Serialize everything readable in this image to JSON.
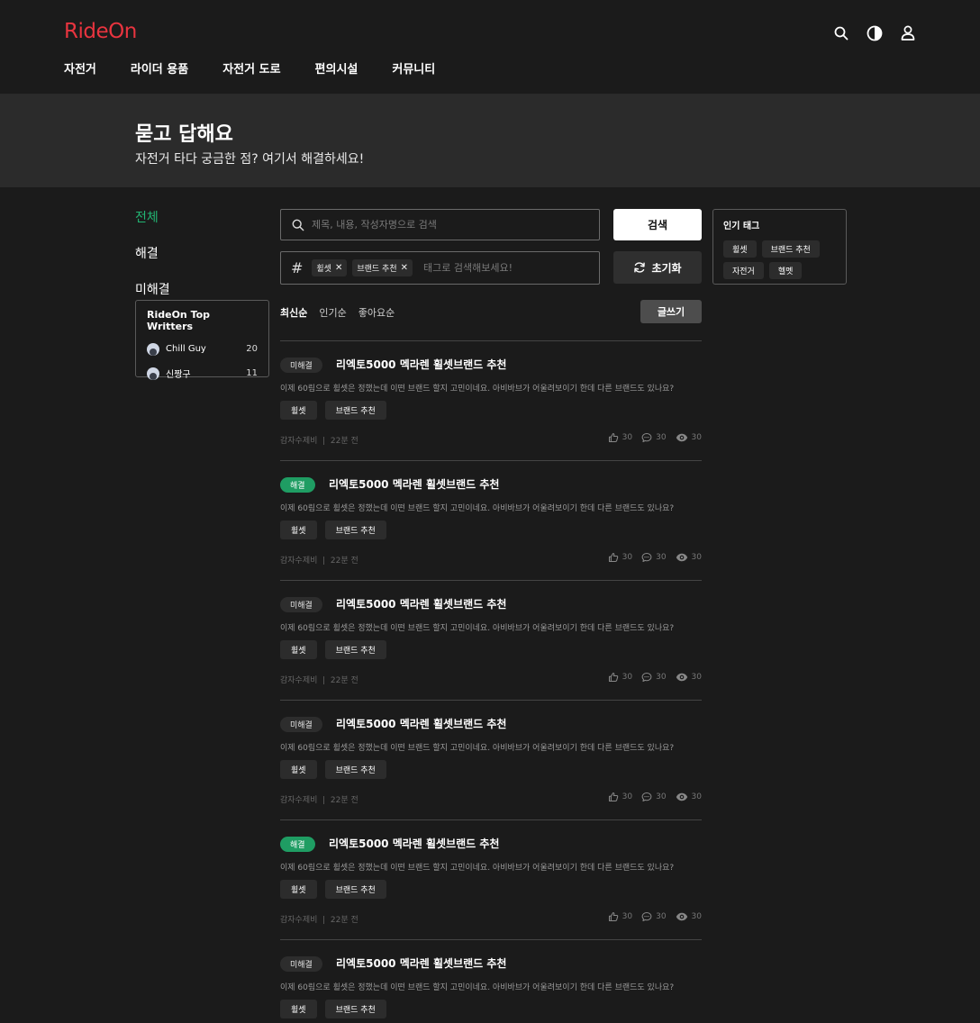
{
  "header": {
    "logo": "RideOn",
    "nav": [
      "자전거",
      "라이더 용품",
      "자전거 도로",
      "편의시설",
      "커뮤니티"
    ],
    "icons": [
      "search-icon",
      "theme-toggle-icon",
      "user-icon"
    ]
  },
  "banner": {
    "title": "묻고 답해요",
    "subtitle": "자전거 타다 궁금한 점? 여기서 해결하세요!"
  },
  "filters": [
    "전체",
    "해결",
    "미해결"
  ],
  "top_writers": {
    "title": "RideOn Top Writters",
    "writers": [
      {
        "name": "Chill Guy",
        "count": "20"
      },
      {
        "name": "신짱구",
        "count": "11"
      }
    ]
  },
  "search": {
    "placeholder": "제목, 내용, 작성자명으로 검색",
    "button": "검색"
  },
  "tag_search": {
    "chips": [
      "휠셋",
      "브랜드 추천"
    ],
    "placeholder": "태그로 검색해보세요!",
    "reset_button": "초기화"
  },
  "popular_tags": {
    "title": "인기 태그",
    "tags": [
      "휠셋",
      "브랜드 추천",
      "자전거",
      "헬멧"
    ]
  },
  "sort": [
    "최신순",
    "인기순",
    "좋아요순"
  ],
  "write_button": "글쓰기",
  "posts": [
    {
      "status": "미해결",
      "solved": false,
      "title": "리엑토5000 멕라렌 휠셋브랜드 추천",
      "desc": "이제 60림으로 휠셋은 정했는데 이떤 브랜드 할지 고민이네요. 아비바브가 어울려보이기 한데 다른 브랜드도 있나요?",
      "tags": [
        "휠셋",
        "브랜드 추천"
      ],
      "author": "감자수제비",
      "time": "22분 전",
      "likes": "30",
      "comments": "30",
      "views": "30"
    },
    {
      "status": "해결",
      "solved": true,
      "title": "리엑토5000 멕라렌 휠셋브랜드 추천",
      "desc": "이제 60림으로 휠셋은 정했는데 이떤 브랜드 할지 고민이네요. 아비바브가 어울려보이기 한데 다른 브랜드도 있나요?",
      "tags": [
        "휠셋",
        "브랜드 추천"
      ],
      "author": "감자수제비",
      "time": "22분 전",
      "likes": "30",
      "comments": "30",
      "views": "30"
    },
    {
      "status": "미해결",
      "solved": false,
      "title": "리엑토5000 멕라렌 휠셋브랜드 추천",
      "desc": "이제 60림으로 휠셋은 정했는데 이떤 브랜드 할지 고민이네요. 아비바브가 어울려보이기 한데 다른 브랜드도 있나요?",
      "tags": [
        "휠셋",
        "브랜드 추천"
      ],
      "author": "감자수제비",
      "time": "22분 전",
      "likes": "30",
      "comments": "30",
      "views": "30"
    },
    {
      "status": "미해결",
      "solved": false,
      "title": "리엑토5000 멕라렌 휠셋브랜드 추천",
      "desc": "이제 60림으로 휠셋은 정했는데 이떤 브랜드 할지 고민이네요. 아비바브가 어울려보이기 한데 다른 브랜드도 있나요?",
      "tags": [
        "휠셋",
        "브랜드 추천"
      ],
      "author": "감자수제비",
      "time": "22분 전",
      "likes": "30",
      "comments": "30",
      "views": "30"
    },
    {
      "status": "해결",
      "solved": true,
      "title": "리엑토5000 멕라렌 휠셋브랜드 추천",
      "desc": "이제 60림으로 휠셋은 정했는데 이떤 브랜드 할지 고민이네요. 아비바브가 어울려보이기 한데 다른 브랜드도 있나요?",
      "tags": [
        "휠셋",
        "브랜드 추천"
      ],
      "author": "감자수제비",
      "time": "22분 전",
      "likes": "30",
      "comments": "30",
      "views": "30"
    },
    {
      "status": "미해결",
      "solved": false,
      "title": "리엑토5000 멕라렌 휠셋브랜드 추천",
      "desc": "이제 60림으로 휠셋은 정했는데 이떤 브랜드 할지 고민이네요. 아비바브가 어울려보이기 한데 다른 브랜드도 있나요?",
      "tags": [
        "휠셋",
        "브랜드 추천"
      ],
      "author": "",
      "time": "",
      "likes": "",
      "comments": "",
      "views": ""
    }
  ],
  "colors": {
    "brand": "#e8343f",
    "accent": "#22b573",
    "solved": "#1f9d63"
  }
}
